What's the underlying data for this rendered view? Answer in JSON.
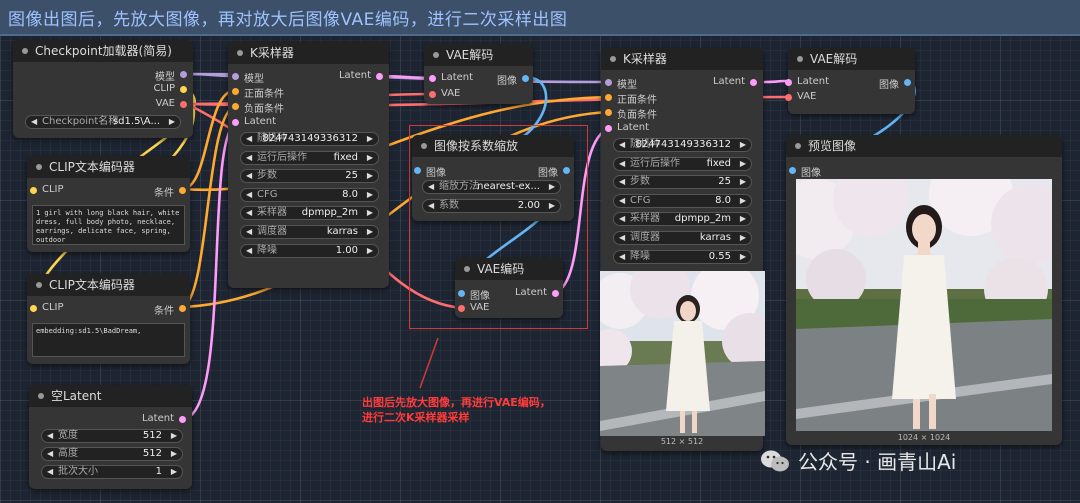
{
  "group": {
    "title": "图像出图后，先放大图像，再对放大后图像VAE编码，进行二次采样出图"
  },
  "colors": {
    "model": "#b39ddb",
    "clip": "#ffd54f",
    "vae": "#ff6e6e",
    "latent": "#ff9cf9",
    "image": "#64b5f6",
    "conditioning": "#ffa931"
  },
  "checkpoint_loader": {
    "title": "Checkpoint加载器(简易)",
    "outputs": [
      "模型",
      "CLIP",
      "VAE"
    ],
    "ckpt": {
      "label": "Checkpoint名称",
      "value": "sd1.5\\A..."
    }
  },
  "clip_pos": {
    "title": "CLIP文本编码器",
    "input": "CLIP",
    "output": "条件",
    "text": "1 girl with long black hair, white dress, full body photo, necklace, earrings, delicate face, spring, outdoor"
  },
  "clip_neg": {
    "title": "CLIP文本编码器",
    "input": "CLIP",
    "output": "条件",
    "text": "embedding:sd1.5\\BadDream,"
  },
  "empty_latent": {
    "title": "空Latent",
    "output": "Latent",
    "widgets": [
      {
        "label": "宽度",
        "value": "512"
      },
      {
        "label": "高度",
        "value": "512"
      },
      {
        "label": "批次大小",
        "value": "1"
      }
    ]
  },
  "ksampler1": {
    "title": "K采样器",
    "inputs": [
      "模型",
      "正面条件",
      "负面条件",
      "Latent"
    ],
    "output": "Latent",
    "widgets": [
      {
        "label": "随机种",
        "value": "824743149336312"
      },
      {
        "label": "运行后操作",
        "value": "fixed"
      },
      {
        "label": "步数",
        "value": "25"
      },
      {
        "label": "CFG",
        "value": "8.0"
      },
      {
        "label": "采样器",
        "value": "dpmpp_2m"
      },
      {
        "label": "调度器",
        "value": "karras"
      },
      {
        "label": "降噪",
        "value": "1.00"
      }
    ]
  },
  "vae_decode1": {
    "title": "VAE解码",
    "inputs": [
      "Latent",
      "VAE"
    ],
    "output": "图像"
  },
  "upscale": {
    "title": "图像按系数缩放",
    "input": "图像",
    "output": "图像",
    "widgets": [
      {
        "label": "缩放方法",
        "value": "nearest-ex..."
      },
      {
        "label": "系数",
        "value": "2.00"
      }
    ]
  },
  "vae_encode": {
    "title": "VAE编码",
    "inputs": [
      "图像",
      "VAE"
    ],
    "output": "Latent"
  },
  "ksampler2": {
    "title": "K采样器",
    "inputs": [
      "模型",
      "正面条件",
      "负面条件",
      "Latent"
    ],
    "output": "Latent",
    "widgets": [
      {
        "label": "随机种",
        "value": "824743149336312"
      },
      {
        "label": "运行后操作",
        "value": "fixed"
      },
      {
        "label": "步数",
        "value": "25"
      },
      {
        "label": "CFG",
        "value": "8.0"
      },
      {
        "label": "采样器",
        "value": "dpmpp_2m"
      },
      {
        "label": "调度器",
        "value": "karras"
      },
      {
        "label": "降噪",
        "value": "0.55"
      }
    ],
    "preview_caption": "512 × 512"
  },
  "vae_decode2": {
    "title": "VAE解码",
    "inputs": [
      "Latent",
      "VAE"
    ],
    "output": "图像"
  },
  "preview": {
    "title": "预览图像",
    "input": "图像",
    "caption": "1024 × 1024"
  },
  "annotation": {
    "line1": "出图后先放大图像，再进行VAE编码，",
    "line2": "进行二次K采样器采样"
  },
  "watermark": {
    "text": "公众号 · 画青山Ai",
    "icon": "wechat-icon"
  }
}
